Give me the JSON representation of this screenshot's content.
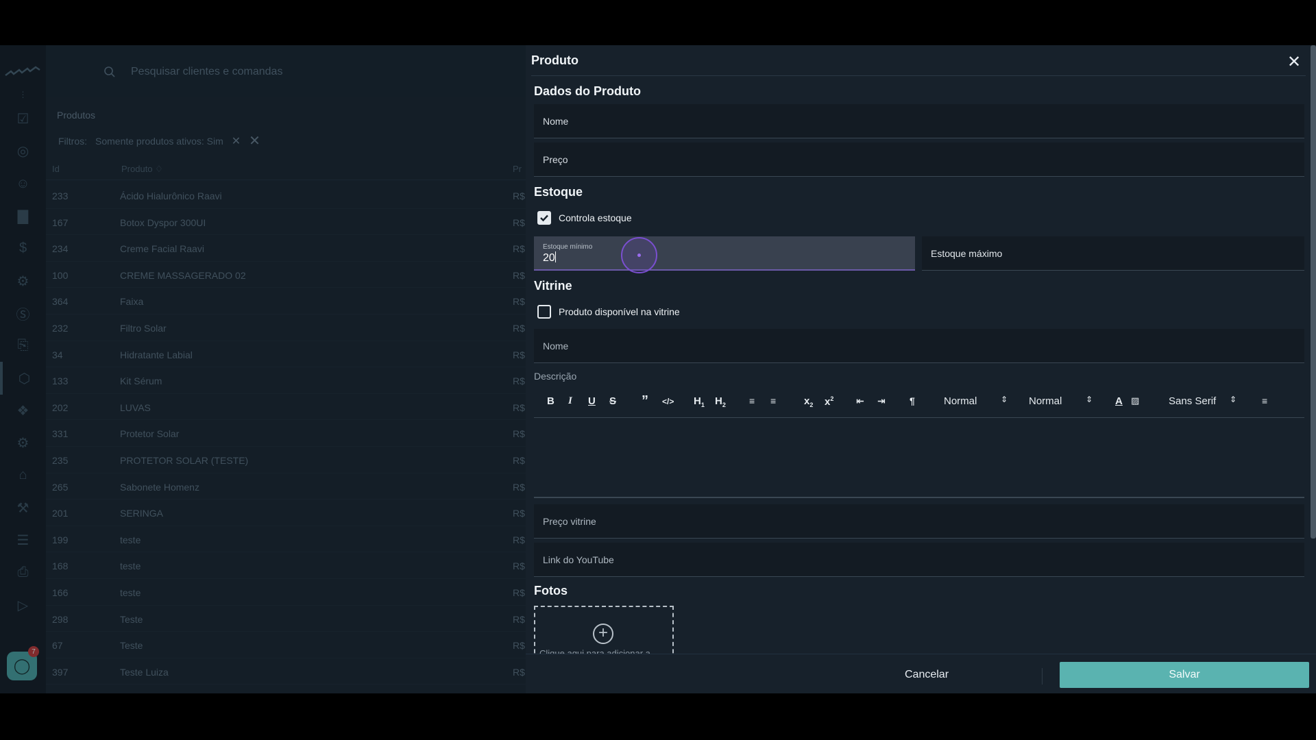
{
  "search": {
    "placeholder": "Pesquisar clientes e comandas"
  },
  "page": {
    "breadcrumb": "Produtos",
    "filters_label": "Filtros:",
    "filter_chip": "Somente produtos ativos: Sim",
    "columns": {
      "id": "Id",
      "product": "Produto ♢",
      "price": "Pr"
    },
    "rows": [
      {
        "id": "233",
        "name": "Ácido Hialurônico Raavi",
        "price": "R$"
      },
      {
        "id": "167",
        "name": "Botox Dyspor 300UI",
        "price": "R$"
      },
      {
        "id": "234",
        "name": "Creme Facial Raavi",
        "price": "R$"
      },
      {
        "id": "100",
        "name": "CREME MASSAGERADO 02",
        "price": "R$"
      },
      {
        "id": "364",
        "name": "Faixa",
        "price": "R$"
      },
      {
        "id": "232",
        "name": "Filtro Solar",
        "price": "R$"
      },
      {
        "id": "34",
        "name": "Hidratante Labial",
        "price": "R$"
      },
      {
        "id": "133",
        "name": "Kit Sérum",
        "price": "R$"
      },
      {
        "id": "202",
        "name": "LUVAS",
        "price": "R$"
      },
      {
        "id": "331",
        "name": "Protetor Solar",
        "price": "R$"
      },
      {
        "id": "235",
        "name": "PROTETOR SOLAR (TESTE)",
        "price": "R$"
      },
      {
        "id": "265",
        "name": "Sabonete Homenz",
        "price": "R$"
      },
      {
        "id": "201",
        "name": "SERINGA",
        "price": "R$"
      },
      {
        "id": "199",
        "name": "teste",
        "price": "R$"
      },
      {
        "id": "168",
        "name": "teste",
        "price": "R$"
      },
      {
        "id": "166",
        "name": "teste",
        "price": "R$"
      },
      {
        "id": "298",
        "name": "Teste",
        "price": "R$"
      },
      {
        "id": "67",
        "name": "Teste",
        "price": "R$"
      },
      {
        "id": "397",
        "name": "Teste Luiza",
        "price": "R$"
      }
    ]
  },
  "sidebar": {
    "icons": [
      "menu-icon",
      "checklist-icon",
      "target-icon",
      "user-icon",
      "chart-icon",
      "dollar-icon",
      "settings-gear-icon",
      "coin-icon",
      "document-icon",
      "box-icon",
      "cubes-icon",
      "gear-icon",
      "store-icon",
      "wrench-icon",
      "server-icon",
      "file-icon",
      "play-icon"
    ],
    "chat_badge": "7"
  },
  "drawer": {
    "title": "Produto",
    "sections": {
      "product_data": "Dados do Produto",
      "stock": "Estoque",
      "showcase": "Vitrine",
      "photos": "Fotos"
    },
    "fields": {
      "name_placeholder": "Nome",
      "price_placeholder": "Preço",
      "stock_min_label": "Estoque mínimo",
      "stock_min_value": "20",
      "stock_max_placeholder": "Estoque máximo",
      "showcase_name_placeholder": "Nome",
      "description_label": "Descrição",
      "showcase_price_placeholder": "Preço vitrine",
      "youtube_placeholder": "Link do YouTube"
    },
    "checks": {
      "control_stock": "Controla estoque",
      "control_stock_checked": true,
      "available_showcase": "Produto disponível na vitrine",
      "available_showcase_checked": false
    },
    "toolbar": {
      "header_select": "Normal",
      "size_select": "Normal",
      "font_select": "Sans Serif"
    },
    "photo_hint": "Clique aqui para adicionar a",
    "buttons": {
      "cancel": "Cancelar",
      "save": "Salvar"
    }
  },
  "colors": {
    "accent": "#5ab3b0",
    "focus": "#7a4fd0",
    "background": "#17212b"
  }
}
